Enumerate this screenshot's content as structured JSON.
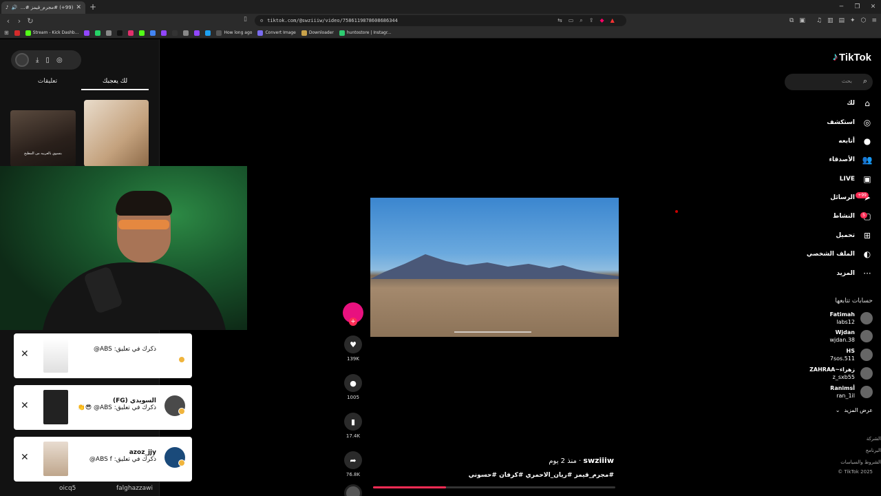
{
  "browser": {
    "tab_title": "(99+) #مجرم_قيمز #ريان_الاحمـ...",
    "url": "tiktok.com/@swziiiw/video/7586119878608686344",
    "bookmarks": [
      {
        "label": "",
        "color": "#d42b2b"
      },
      {
        "label": "Stream - Kick Dashb...",
        "color": "#53fc18"
      },
      {
        "label": "",
        "color": "#9146ff"
      },
      {
        "label": "",
        "color": "#25d366"
      },
      {
        "label": "",
        "color": "#888"
      },
      {
        "label": "",
        "color": "#111"
      },
      {
        "label": "",
        "color": "#e1306c"
      },
      {
        "label": "",
        "color": "#53fc18"
      },
      {
        "label": "",
        "color": "#4285f4"
      },
      {
        "label": "",
        "color": "#9146ff"
      },
      {
        "label": "",
        "color": "#333"
      },
      {
        "label": "",
        "color": "#888"
      },
      {
        "label": "",
        "color": "#9146ff"
      },
      {
        "label": "",
        "color": "#1da1f2"
      },
      {
        "label": "How long ago",
        "color": "#555"
      },
      {
        "label": "Convert Image",
        "color": "#7a6cf0"
      },
      {
        "label": "Downloader",
        "color": "#c9a24a"
      },
      {
        "label": "huntostore | Instagr...",
        "color": "#2ecc71"
      }
    ]
  },
  "left_panel": {
    "tabs": [
      "لك يعجبك",
      "تعليقات"
    ],
    "thumb_caption": "بنسوي بالعربيه من المطبخ",
    "bottom_names": [
      "oicq5",
      "falghazzawi"
    ]
  },
  "notifications": [
    {
      "name": "",
      "text": "ذكرك في تعليق: ABS@"
    },
    {
      "name": "السويدي (FG)",
      "text": "ذكرك في تعليق: ABS@ 😎👏"
    },
    {
      "name": "azoz_jjy",
      "text": "ذكرك في تعليق: ABS f@"
    }
  ],
  "video": {
    "author": "swziiiw",
    "time": "· منذ 2 يوم",
    "hashtags": "#مجرم_قيمز #ريان_الاحمري #كرفان #حسوني",
    "progress": 0.3,
    "likes": "139K",
    "comments": "1005",
    "saves": "17.4K",
    "shares": "76.8K"
  },
  "sidebar": {
    "logo": "TikTok",
    "search_placeholder": "بحث",
    "nav": [
      {
        "label": "لك",
        "icon": "home-icon",
        "glyph": "⌂"
      },
      {
        "label": "استكشف",
        "icon": "compass-icon",
        "glyph": "◎"
      },
      {
        "label": "أتابعه",
        "icon": "following-avatar-icon",
        "glyph": "●"
      },
      {
        "label": "الأصدقاء",
        "icon": "friends-icon",
        "glyph": "👥"
      },
      {
        "label": "LIVE",
        "icon": "live-icon",
        "glyph": "▣"
      },
      {
        "label": "الرسائل",
        "icon": "messages-icon",
        "glyph": "➤"
      },
      {
        "label": "النشاط",
        "icon": "activity-icon",
        "glyph": "▢"
      },
      {
        "label": "تحميل",
        "icon": "upload-icon",
        "glyph": "⊞"
      },
      {
        "label": "الملف الشخصي",
        "icon": "profile-icon",
        "glyph": "◐"
      },
      {
        "label": "المزيد",
        "icon": "more-icon",
        "glyph": "···"
      }
    ],
    "messages_badge": "+99",
    "activity_badge": "5",
    "following_title": "حسابات تتابعها",
    "following": [
      {
        "line1": "Fatimah",
        "line2": "labs12"
      },
      {
        "line1": "Wjdan",
        "line2": "wjdan.38"
      },
      {
        "line1": "HS",
        "line2": "7sos.511"
      },
      {
        "line1": "ZAHRAA~زهراء",
        "line2": "z_sxb55"
      },
      {
        "line1": "Ranimsأ",
        "line2": "ran_1il"
      }
    ],
    "see_more": "عرض المزيد",
    "footer": [
      "الشركة",
      "البرنامج",
      "الشروط والسياسات"
    ],
    "copyright": "© TikTok 2025"
  }
}
